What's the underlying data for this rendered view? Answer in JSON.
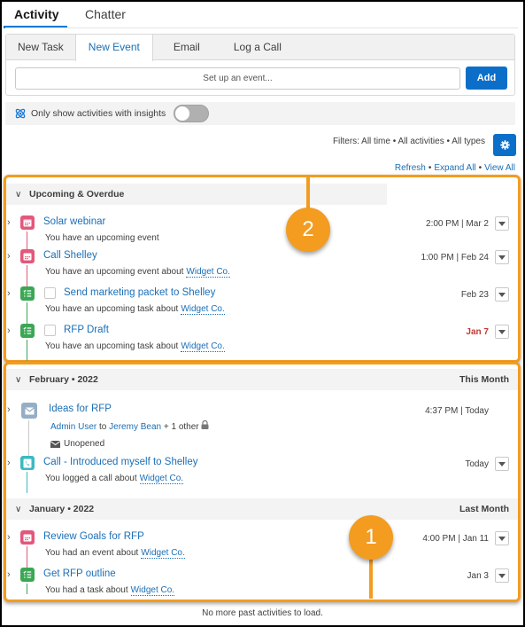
{
  "tabs": [
    {
      "label": "Activity",
      "active": true
    },
    {
      "label": "Chatter",
      "active": false
    }
  ],
  "composer": {
    "tabs": [
      {
        "label": "New Task",
        "active": false
      },
      {
        "label": "New Event",
        "active": true
      },
      {
        "label": "Email",
        "active": false
      },
      {
        "label": "Log a Call",
        "active": false
      }
    ],
    "placeholder": "Set up an event...",
    "add_label": "Add"
  },
  "insights": {
    "label": "Only show activities with insights",
    "toggle_on": false
  },
  "filters": {
    "text": "Filters: All time • All activities • All types",
    "icon": "gear-icon"
  },
  "links": {
    "refresh": "Refresh",
    "expand_all": "Expand All",
    "view_all": "View All",
    "separator": "•"
  },
  "sections": [
    {
      "title": "Upcoming & Overdue",
      "right_label": "",
      "callout": "2",
      "items": [
        {
          "type": "event",
          "title": "Solar webinar",
          "subtitle": "You have an upcoming event",
          "link": "",
          "date": "2:00 PM | Mar 2",
          "overdue": false
        },
        {
          "type": "event",
          "title": "Call Shelley",
          "subtitle": "You have an upcoming event about",
          "link": "Widget Co.",
          "date": "1:00 PM | Feb 24",
          "overdue": false
        },
        {
          "type": "task",
          "title": "Send marketing packet to Shelley",
          "subtitle": "You have an upcoming task about",
          "link": "Widget Co.",
          "date": "Feb 23",
          "overdue": false
        },
        {
          "type": "task",
          "title": "RFP Draft",
          "subtitle": "You have an upcoming task about",
          "link": "Widget Co.",
          "date": "Jan 7",
          "overdue": true
        }
      ]
    },
    {
      "title": "February • 2022",
      "right_label": "This Month",
      "items": [
        {
          "type": "email",
          "title": "Ideas for RFP",
          "from": "Admin User",
          "to_word": "to",
          "to": "Jeremy Bean",
          "others": "+ 1 other",
          "status": "Unopened",
          "date": "4:37 PM | Today"
        },
        {
          "type": "call",
          "title": "Call - Introduced myself to Shelley",
          "subtitle": "You logged a call about",
          "link": "Widget Co.",
          "date": "Today"
        }
      ]
    },
    {
      "title": "January • 2022",
      "right_label": "Last Month",
      "callout": "1",
      "items": [
        {
          "type": "event",
          "title": "Review Goals for RFP",
          "subtitle": "You had an event about",
          "link": "Widget Co.",
          "date": "4:00 PM | Jan 11"
        },
        {
          "type": "task",
          "title": "Get RFP outline",
          "subtitle": "You had a task about",
          "link": "Widget Co.",
          "date": "Jan 3"
        }
      ]
    }
  ],
  "footer": "No more past activities to load.",
  "colors": {
    "accent": "#0b6fc9",
    "link": "#1b6fb6",
    "event": "#e3587b",
    "task": "#3ba755",
    "email": "#95aec5",
    "call": "#3bbac3",
    "callout": "#f39c1f",
    "overdue": "#c23934"
  }
}
